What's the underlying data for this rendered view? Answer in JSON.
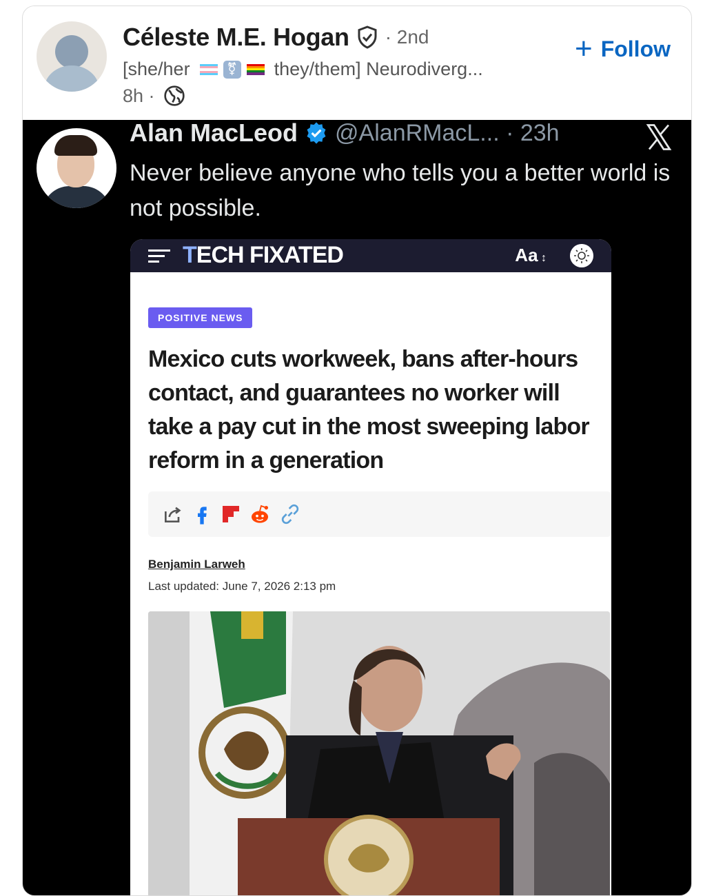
{
  "post": {
    "author_name": "Céleste M.E. Hogan",
    "degree": "· 2nd",
    "headline_start": "[she/her",
    "headline_end": "they/them] Neurodiverg...",
    "time": "8h ·",
    "follow_label": "Follow",
    "icons": {
      "verified_shield": "shield-check-icon",
      "visibility": "globe-icon",
      "pronoun_symbol": "⚧"
    }
  },
  "tweet": {
    "name": "Alan MacLeod",
    "handle": "@AlanRMacL... · 23h",
    "text": "Never believe anyone who tells you a better world is not possible.",
    "article": {
      "site_name_first": "T",
      "site_name_rest": "ECH FIXATED",
      "font_toggle": "Aa",
      "badge": "POSITIVE NEWS",
      "headline": "Mexico cuts workweek, bans after-hours contact, and guarantees no worker will take a pay cut in the most sweeping labor reform in a generation",
      "author": "Benjamin Larweh",
      "updated": "Last updated: June 7, 2026 2:13 pm"
    }
  },
  "colors": {
    "link_blue": "#0a66c2",
    "tweet_bg": "#000000",
    "badge": "#6a5cf0",
    "article_bar": "#1c1c30"
  }
}
